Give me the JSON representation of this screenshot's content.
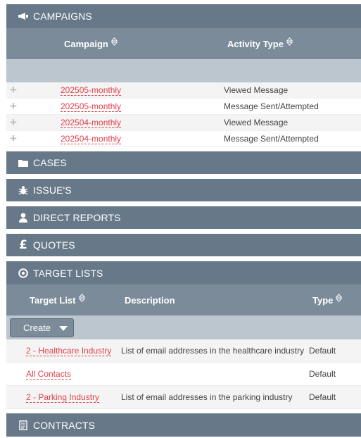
{
  "campaigns": {
    "title": "CAMPAIGNS",
    "icon": "megaphone-icon",
    "columns": {
      "campaign": "Campaign",
      "activity_type": "Activity Type"
    },
    "rows": [
      {
        "campaign": "202505-monthly",
        "activity": "Viewed Message"
      },
      {
        "campaign": "202505-monthly",
        "activity": "Message Sent/Attempted"
      },
      {
        "campaign": "202504-monthly",
        "activity": "Viewed Message"
      },
      {
        "campaign": "202504-monthly",
        "activity": "Message Sent/Attempted"
      }
    ]
  },
  "sections": {
    "cases": {
      "title": "CASES",
      "icon": "folder-icon"
    },
    "issues": {
      "title": "ISSUE'S",
      "icon": "bug-icon"
    },
    "direct_reports": {
      "title": "DIRECT REPORTS",
      "icon": "person-icon"
    },
    "quotes": {
      "title": "QUOTES",
      "icon": "pound-icon"
    },
    "contracts": {
      "title": "CONTRACTS",
      "icon": "document-icon"
    }
  },
  "target_lists": {
    "title": "TARGET LISTS",
    "icon": "target-icon",
    "columns": {
      "target_list": "Target List",
      "description": "Description",
      "type": "Type"
    },
    "create_label": "Create",
    "rows": [
      {
        "name": "2 - Healthcare Industry",
        "description": "List of email addresses in the healthcare industry",
        "type": "Default"
      },
      {
        "name": "All Contacts",
        "description": "",
        "type": "Default"
      },
      {
        "name": "2 - Parking Industry",
        "description": "List of email addresses in the parking industry",
        "type": "Default"
      }
    ]
  },
  "colors": {
    "header": "#677888",
    "column_header": "#7b8b99",
    "link": "#e0434d",
    "subbar": "#bcc6cf"
  }
}
